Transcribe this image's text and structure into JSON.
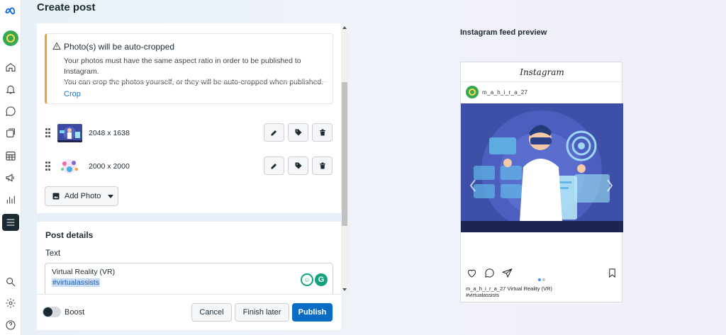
{
  "header": {
    "title": "Create post"
  },
  "warning": {
    "title": "Photo(s) will be auto-cropped",
    "body_line1": "Your photos must have the same aspect ratio in order to be published to Instagram.",
    "body_line2": "You can crop the photos yourself, or they will be auto-cropped when published.",
    "link": "Crop"
  },
  "photos": [
    {
      "dims": "2048 x 1638"
    },
    {
      "dims": "2000 x 2000"
    }
  ],
  "add_photo": {
    "label": "Add Photo"
  },
  "post_details": {
    "title": "Post details",
    "text_label": "Text",
    "text_line1": "Virtual Reality (VR)",
    "text_line2": "#virtualassists"
  },
  "footer": {
    "boost_label": "Boost",
    "cancel": "Cancel",
    "finish_later": "Finish later",
    "publish": "Publish"
  },
  "preview": {
    "title": "Instagram feed preview",
    "logo_text": "Instagram",
    "username": "m_a_h_i_r_a_27",
    "caption_line1": "m_a_h_i_r_a_27 Virtual Reality (VR)",
    "caption_line2": "#virtualassists"
  },
  "colors": {
    "publish": "#0a6cc2",
    "warning_accent": "#e8a33d",
    "link": "#1d6fb8",
    "grammarly": "#15a37f"
  },
  "icons": [
    "meta-logo",
    "home-icon",
    "bell-icon",
    "chat-icon",
    "content-icon",
    "calendar-icon",
    "megaphone-icon",
    "insights-icon",
    "menu-icon",
    "search-icon",
    "settings-icon",
    "help-icon"
  ]
}
